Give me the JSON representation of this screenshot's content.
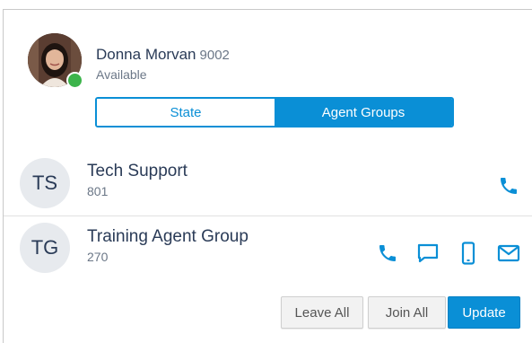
{
  "user": {
    "name": "Donna Morvan",
    "extension": "9002",
    "status": "Available",
    "presence_color": "#3cb44b"
  },
  "tabs": [
    {
      "label": "State",
      "selected": false
    },
    {
      "label": "Agent Groups",
      "selected": true
    }
  ],
  "groups": [
    {
      "initials": "TS",
      "name": "Tech Support",
      "number": "801",
      "channels": [
        "phone-icon"
      ]
    },
    {
      "initials": "TG",
      "name": "Training Agent Group",
      "number": "270",
      "channels": [
        "phone-icon",
        "chat-icon",
        "mobile-icon",
        "email-icon"
      ]
    }
  ],
  "actions": {
    "leave_all": "Leave All",
    "join_all": "Join All",
    "update": "Update"
  },
  "colors": {
    "accent": "#0a8fd6",
    "text_primary": "#2a3b57",
    "text_secondary": "#6b7787"
  }
}
